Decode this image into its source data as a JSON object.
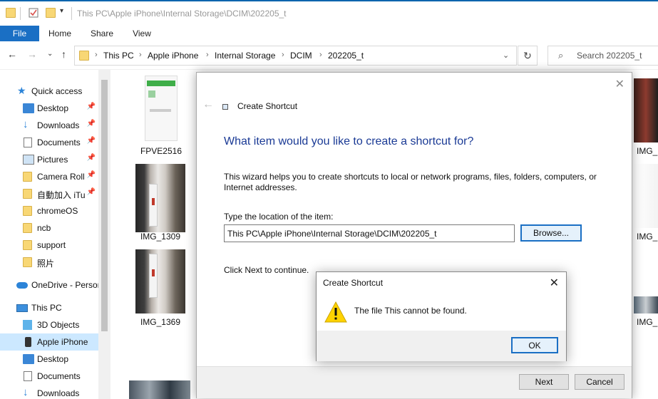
{
  "titlebar": {
    "path": "This PC\\Apple iPhone\\Internal Storage\\DCIM\\202205_t"
  },
  "ribbon": {
    "tabs": [
      "File",
      "Home",
      "Share",
      "View"
    ]
  },
  "address": {
    "crumbs": [
      "This PC",
      "Apple iPhone",
      "Internal Storage",
      "DCIM",
      "202205_t"
    ],
    "search_placeholder": "Search 202205_t"
  },
  "sidebar": {
    "items": [
      {
        "label": "Quick access",
        "icon": "star-icon"
      },
      {
        "label": "Desktop",
        "icon": "desktop-icon",
        "pinned": true
      },
      {
        "label": "Downloads",
        "icon": "download-icon",
        "pinned": true
      },
      {
        "label": "Documents",
        "icon": "document-icon",
        "pinned": true
      },
      {
        "label": "Pictures",
        "icon": "pictures-icon",
        "pinned": true
      },
      {
        "label": "Camera Roll",
        "icon": "folder-icon",
        "pinned": true
      },
      {
        "label": "自動加入 iTu",
        "icon": "folder-icon",
        "pinned": true
      },
      {
        "label": "chromeOS",
        "icon": "folder-icon"
      },
      {
        "label": "ncb",
        "icon": "folder-icon"
      },
      {
        "label": "support",
        "icon": "folder-icon"
      },
      {
        "label": "照片",
        "icon": "folder-icon"
      },
      {
        "label": "OneDrive - Person",
        "icon": "onedrive-icon"
      },
      {
        "label": "This PC",
        "icon": "pc-icon"
      },
      {
        "label": "3D Objects",
        "icon": "3d-objects-icon"
      },
      {
        "label": "Apple iPhone",
        "icon": "iphone-icon",
        "selected": true
      },
      {
        "label": "Desktop",
        "icon": "desktop-icon"
      },
      {
        "label": "Documents",
        "icon": "document-icon"
      },
      {
        "label": "Downloads",
        "icon": "download-icon"
      }
    ]
  },
  "files": [
    {
      "name": "FPVE2516"
    },
    {
      "name": "IMG_1309"
    },
    {
      "name": "IMG_1369"
    },
    {
      "name": "IMG_"
    },
    {
      "name": "IMG_"
    },
    {
      "name": "IMG_"
    }
  ],
  "wizard": {
    "title": "Create Shortcut",
    "heading": "What item would you like to create a shortcut for?",
    "description": "This wizard helps you to create shortcuts to local or network programs, files, folders, computers, or Internet addresses.",
    "location_label": "Type the location of the item:",
    "location_value": "This PC\\Apple iPhone\\Internal Storage\\DCIM\\202205_t",
    "browse_label": "Browse...",
    "continue_text": "Click Next to continue.",
    "next_label": "Next",
    "cancel_label": "Cancel"
  },
  "error": {
    "title": "Create Shortcut",
    "message": "The file This cannot be found.",
    "ok_label": "OK"
  },
  "colors": {
    "accent": "#1a6fc4",
    "heading": "#1a3a95",
    "selection": "#cce8ff",
    "folder": "#f8d775"
  }
}
